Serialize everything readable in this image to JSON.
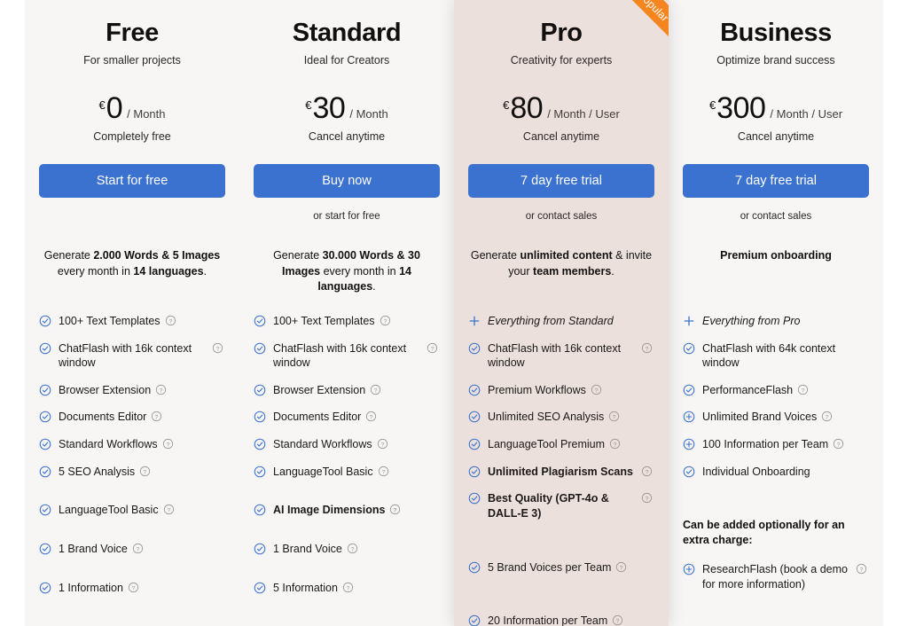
{
  "colors": {
    "accent_blue": "#3b72d0",
    "ribbon_orange": "#f5861f",
    "column_bg": "#f7f6f5",
    "highlight_bg": "#ece0dd",
    "page_bg": "#ffffff"
  },
  "ribbon": {
    "label": "Most popular"
  },
  "plans": [
    {
      "id": "free",
      "name": "Free",
      "tagline": "For smaller projects",
      "currency": "€",
      "amount": "0",
      "period": "/ Month",
      "price_note": "Completely free",
      "cta_label": "Start for free",
      "cta_sub": "",
      "summary_html": "Generate <b>2.000 Words &amp; 5 Images</b> every month in <b>14 languages</b>.",
      "summary_bold": false,
      "highlight": false,
      "features": [
        {
          "icon": "check-icon",
          "label": "100+ Text Templates",
          "help": true,
          "help_inline": true,
          "bold": false,
          "italic": false,
          "gap": 0
        },
        {
          "icon": "check-icon",
          "label": "ChatFlash with 16k context window",
          "help": true,
          "help_inline": false,
          "bold": false,
          "italic": false,
          "gap": 14
        },
        {
          "icon": "check-icon",
          "label": "Browser Extension",
          "help": true,
          "help_inline": true,
          "bold": false,
          "italic": false,
          "gap": 14
        },
        {
          "icon": "check-icon",
          "label": "Documents Editor",
          "help": true,
          "help_inline": true,
          "bold": false,
          "italic": false,
          "gap": 14
        },
        {
          "icon": "check-icon",
          "label": "Standard Workflows",
          "help": true,
          "help_inline": true,
          "bold": false,
          "italic": false,
          "gap": 14
        },
        {
          "icon": "check-icon",
          "label": "5 SEO Analysis",
          "help": true,
          "help_inline": true,
          "bold": false,
          "italic": false,
          "gap": 14
        },
        {
          "icon": "check-icon",
          "label": "LanguageTool Basic",
          "help": true,
          "help_inline": true,
          "bold": false,
          "italic": false,
          "gap": 27
        },
        {
          "icon": "check-icon",
          "label": "1 Brand Voice",
          "help": true,
          "help_inline": true,
          "bold": false,
          "italic": false,
          "gap": 27
        },
        {
          "icon": "check-icon",
          "label": "1 Information",
          "help": true,
          "help_inline": true,
          "bold": false,
          "italic": false,
          "gap": 27
        }
      ],
      "optional": null
    },
    {
      "id": "standard",
      "name": "Standard",
      "tagline": "Ideal for Creators",
      "currency": "€",
      "amount": "30",
      "period": "/ Month",
      "price_note": "Cancel anytime",
      "cta_label": "Buy now",
      "cta_sub": "or start for free",
      "summary_html": "Generate <b>30.000 Words &amp; 30 Images</b> every month in <b>14 languages</b>.",
      "summary_bold": false,
      "highlight": false,
      "features": [
        {
          "icon": "check-icon",
          "label": "100+ Text Templates",
          "help": true,
          "help_inline": true,
          "bold": false,
          "italic": false,
          "gap": 0
        },
        {
          "icon": "check-icon",
          "label": "ChatFlash with 16k context window",
          "help": true,
          "help_inline": false,
          "bold": false,
          "italic": false,
          "gap": 14
        },
        {
          "icon": "check-icon",
          "label": "Browser Extension",
          "help": true,
          "help_inline": true,
          "bold": false,
          "italic": false,
          "gap": 14
        },
        {
          "icon": "check-icon",
          "label": "Documents Editor",
          "help": true,
          "help_inline": true,
          "bold": false,
          "italic": false,
          "gap": 14
        },
        {
          "icon": "check-icon",
          "label": "Standard Workflows",
          "help": true,
          "help_inline": true,
          "bold": false,
          "italic": false,
          "gap": 14
        },
        {
          "icon": "check-icon",
          "label": "LanguageTool Basic",
          "help": true,
          "help_inline": true,
          "bold": false,
          "italic": false,
          "gap": 14
        },
        {
          "icon": "check-icon",
          "label": "AI Image Dimensions",
          "help": true,
          "help_inline": true,
          "bold": true,
          "italic": false,
          "gap": 27
        },
        {
          "icon": "check-icon",
          "label": "1 Brand Voice",
          "help": true,
          "help_inline": true,
          "bold": false,
          "italic": false,
          "gap": 27
        },
        {
          "icon": "check-icon",
          "label": "5 Information",
          "help": true,
          "help_inline": true,
          "bold": false,
          "italic": false,
          "gap": 27
        }
      ],
      "optional": null
    },
    {
      "id": "pro",
      "name": "Pro",
      "tagline": "Creativity for experts",
      "currency": "€",
      "amount": "80",
      "period": "/ Month / User",
      "price_note": "Cancel anytime",
      "cta_label": "7 day free trial",
      "cta_sub": "or contact sales",
      "summary_html": "Generate <b>unlimited content</b> &amp; invite your <b>team members</b>.",
      "summary_bold": false,
      "highlight": true,
      "features": [
        {
          "icon": "plus-icon",
          "label": "Everything from Standard",
          "help": false,
          "help_inline": false,
          "bold": false,
          "italic": true,
          "gap": 0
        },
        {
          "icon": "check-icon",
          "label": "ChatFlash with 16k context window",
          "help": true,
          "help_inline": false,
          "bold": false,
          "italic": false,
          "gap": 14
        },
        {
          "icon": "check-icon",
          "label": "Premium Workflows",
          "help": true,
          "help_inline": true,
          "bold": false,
          "italic": false,
          "gap": 14
        },
        {
          "icon": "check-icon",
          "label": "Unlimited SEO Analysis",
          "help": true,
          "help_inline": true,
          "bold": false,
          "italic": false,
          "gap": 14
        },
        {
          "icon": "check-icon",
          "label": "LanguageTool Premium",
          "help": true,
          "help_inline": true,
          "bold": false,
          "italic": false,
          "gap": 14
        },
        {
          "icon": "check-icon",
          "label": "Unlimited Plagiarism Scans",
          "help": true,
          "help_inline": false,
          "bold": true,
          "italic": false,
          "gap": 14
        },
        {
          "icon": "check-icon",
          "label": "Best Quality (GPT-4o & DALL-E 3)",
          "help": true,
          "help_inline": false,
          "bold": true,
          "italic": false,
          "gap": 14
        },
        {
          "icon": "check-icon",
          "label": "5 Brand Voices per Team",
          "help": true,
          "help_inline": true,
          "bold": false,
          "italic": false,
          "gap": 44
        },
        {
          "icon": "check-icon",
          "label": "20 Information per Team",
          "help": true,
          "help_inline": true,
          "bold": false,
          "italic": false,
          "gap": 44
        }
      ],
      "optional": null
    },
    {
      "id": "business",
      "name": "Business",
      "tagline": "Optimize brand success",
      "currency": "€",
      "amount": "300",
      "period": "/ Month / User",
      "price_note": "Cancel anytime",
      "cta_label": "7 day free trial",
      "cta_sub": "or contact sales",
      "summary_html": "Premium onboarding",
      "summary_bold": true,
      "highlight": false,
      "features": [
        {
          "icon": "plus-icon",
          "label": "Everything from Pro",
          "help": false,
          "help_inline": false,
          "bold": false,
          "italic": true,
          "gap": 0
        },
        {
          "icon": "check-icon",
          "label": "ChatFlash with 64k context window",
          "help": false,
          "help_inline": false,
          "bold": false,
          "italic": false,
          "gap": 14
        },
        {
          "icon": "check-icon",
          "label": "PerformanceFlash",
          "help": true,
          "help_inline": true,
          "bold": false,
          "italic": false,
          "gap": 14
        },
        {
          "icon": "circle-plus-icon",
          "label": "Unlimited Brand Voices",
          "help": true,
          "help_inline": true,
          "bold": false,
          "italic": false,
          "gap": 14
        },
        {
          "icon": "circle-plus-icon",
          "label": "100 Information per Team",
          "help": true,
          "help_inline": true,
          "bold": false,
          "italic": false,
          "gap": 14
        },
        {
          "icon": "check-icon",
          "label": "Individual Onboarding",
          "help": false,
          "help_inline": false,
          "bold": false,
          "italic": false,
          "gap": 14
        }
      ],
      "optional": {
        "title": "Can be added optionally for an extra charge:",
        "gap": 44,
        "items": [
          {
            "icon": "circle-plus-icon",
            "label": "ResearchFlash (book a demo for more information)",
            "help": true,
            "help_inline": false,
            "bold": false,
            "italic": false,
            "gap": 16
          }
        ]
      }
    }
  ]
}
